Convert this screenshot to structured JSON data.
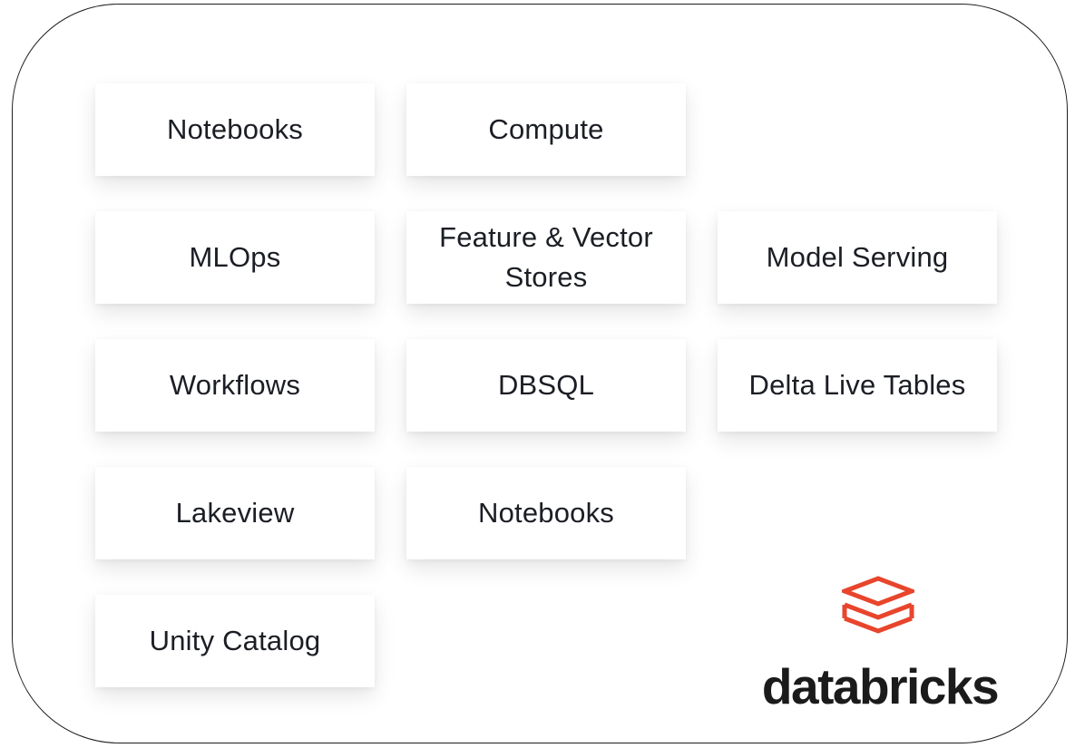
{
  "tiles": {
    "notebooks_top": "Notebooks",
    "compute": "Compute",
    "mlops": "MLOps",
    "feature_vector_stores": "Feature & Vector Stores",
    "model_serving": "Model Serving",
    "workflows": "Workflows",
    "dbsql": "DBSQL",
    "delta_live_tables": "Delta Live Tables",
    "lakeview": "Lakeview",
    "notebooks_bottom": "Notebooks",
    "unity_catalog": "Unity Catalog"
  },
  "logo": {
    "text": "databricks",
    "icon": "databricks-stack-icon",
    "color": "#e8452c"
  },
  "colors": {
    "border": "#1f1f1f",
    "tile_text": "#1b1e24",
    "logo_text": "#1b1b1b"
  }
}
